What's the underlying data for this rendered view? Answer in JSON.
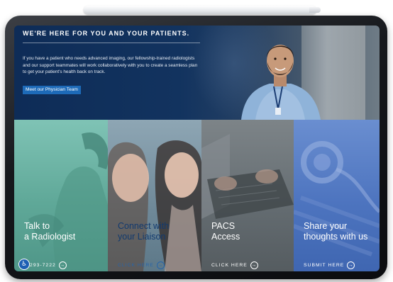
{
  "hero": {
    "title": "WE'RE HERE FOR YOU AND YOUR PATIENTS.",
    "body": "If you have a patient who needs advanced imaging, our fellowship-trained radiologists and our support teammates will work collaboratively with you to create a seamless plan to get your patient's health back on track.",
    "button_label": "Meet our Physician Team"
  },
  "tiles": [
    {
      "heading_line1": "Talk to",
      "heading_line2": "a Radiologist",
      "link_text": "0-293-7222",
      "arrow_icon": "arrow-circle-icon"
    },
    {
      "heading_line1": "Connect with",
      "heading_line2": "your Liaison",
      "link_text": "CLICK HERE",
      "arrow_icon": "arrow-circle-icon"
    },
    {
      "heading_line1": "PACS",
      "heading_line2": "Access",
      "link_text": "CLICK HERE",
      "arrow_icon": "arrow-circle-icon"
    },
    {
      "heading_line1": "Share your",
      "heading_line2": "thoughts with us",
      "link_text": "SUBMIT HERE",
      "arrow_icon": "arrow-circle-icon"
    }
  ],
  "colors": {
    "hero_navy": "#0e2c57",
    "button_blue": "#1d6ab8",
    "tile_teal": "#5fa898",
    "tile_slate": "#6e8898",
    "tile_gray": "#636b70",
    "tile_blue": "#4d74bf"
  },
  "icons": {
    "accessibility": "accessibility-icon"
  }
}
